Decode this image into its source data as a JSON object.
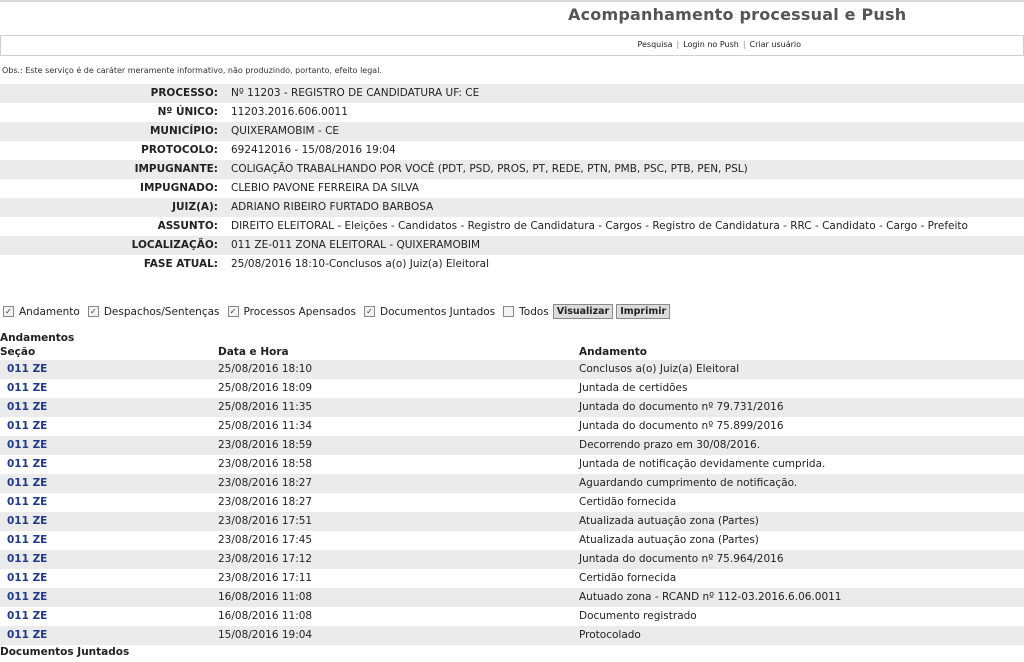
{
  "header": {
    "title": "Acompanhamento processual e Push"
  },
  "links": {
    "pesquisa": "Pesquisa",
    "login": "Login no Push",
    "criar": "Criar usuário"
  },
  "obs": "Obs.: Este serviço é de caráter meramente informativo, não produzindo, portanto, efeito legal.",
  "info": [
    {
      "label": "PROCESSO:",
      "value": "Nº 11203 - REGISTRO DE CANDIDATURA UF: CE"
    },
    {
      "label": "Nº ÚNICO:",
      "value": "11203.2016.606.0011"
    },
    {
      "label": "MUNICÍPIO:",
      "value": "QUIXERAMOBIM - CE"
    },
    {
      "label": "PROTOCOLO:",
      "value": "692412016 - 15/08/2016 19:04"
    },
    {
      "label": "IMPUGNANTE:",
      "value": "COLIGAÇÃO TRABALHANDO POR VOCÊ (PDT, PSD, PROS, PT, REDE, PTN, PMB, PSC, PTB, PEN, PSL)"
    },
    {
      "label": "IMPUGNADO:",
      "value": "CLEBIO PAVONE FERREIRA DA SILVA"
    },
    {
      "label": "JUIZ(A):",
      "value": "ADRIANO RIBEIRO FURTADO BARBOSA"
    },
    {
      "label": "ASSUNTO:",
      "value": "DIREITO ELEITORAL - Eleições - Candidatos - Registro de Candidatura - Cargos - Registro de Candidatura - RRC - Candidato - Cargo - Prefeito"
    },
    {
      "label": "LOCALIZAÇÃO:",
      "value": "011 ZE-011 ZONA ELEITORAL - QUIXERAMOBIM"
    },
    {
      "label": "FASE ATUAL:",
      "value": "25/08/2016 18:10-Conclusos a(o) Juiz(a) Eleitoral"
    }
  ],
  "filters": {
    "andamento": "Andamento",
    "despachos": "Despachos/Sentenças",
    "apensados": "Processos Apensados",
    "juntados": "Documentos Juntados",
    "todos": "Todos",
    "visualizar": "Visualizar",
    "imprimir": "Imprimir"
  },
  "andamentos": {
    "title": "Andamentos",
    "columns": {
      "secao": "Seção",
      "data": "Data e Hora",
      "andamento": "Andamento"
    },
    "rows": [
      {
        "secao": "011 ZE",
        "data": "25/08/2016 18:10",
        "andamento": "Conclusos a(o) Juiz(a) Eleitoral"
      },
      {
        "secao": "011 ZE",
        "data": "25/08/2016 18:09",
        "andamento": "Juntada de certidões"
      },
      {
        "secao": "011 ZE",
        "data": "25/08/2016 11:35",
        "andamento": "Juntada do documento nº 79.731/2016"
      },
      {
        "secao": "011 ZE",
        "data": "25/08/2016 11:34",
        "andamento": "Juntada do documento nº 75.899/2016"
      },
      {
        "secao": "011 ZE",
        "data": "23/08/2016 18:59",
        "andamento": "Decorrendo prazo em 30/08/2016."
      },
      {
        "secao": "011 ZE",
        "data": "23/08/2016 18:58",
        "andamento": "Juntada de notificação devidamente cumprida."
      },
      {
        "secao": "011 ZE",
        "data": "23/08/2016 18:27",
        "andamento": "Aguardando cumprimento de notificação."
      },
      {
        "secao": "011 ZE",
        "data": "23/08/2016 18:27",
        "andamento": "Certidão fornecida"
      },
      {
        "secao": "011 ZE",
        "data": "23/08/2016 17:51",
        "andamento": "Atualizada autuação zona (Partes)"
      },
      {
        "secao": "011 ZE",
        "data": "23/08/2016 17:45",
        "andamento": "Atualizada autuação zona (Partes)"
      },
      {
        "secao": "011 ZE",
        "data": "23/08/2016 17:12",
        "andamento": "Juntada do documento nº 75.964/2016"
      },
      {
        "secao": "011 ZE",
        "data": "23/08/2016 17:11",
        "andamento": "Certidão fornecida"
      },
      {
        "secao": "011 ZE",
        "data": "16/08/2016 11:08",
        "andamento": "Autuado zona - RCAND nº 112-03.2016.6.06.0011"
      },
      {
        "secao": "011 ZE",
        "data": "16/08/2016 11:08",
        "andamento": "Documento registrado"
      },
      {
        "secao": "011 ZE",
        "data": "15/08/2016 19:04",
        "andamento": "Protocolado"
      }
    ]
  },
  "documentos": {
    "title": "Documentos Juntados"
  }
}
